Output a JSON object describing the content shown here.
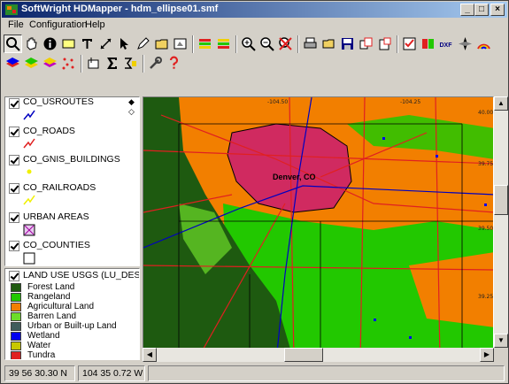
{
  "window": {
    "title": "SoftWright HDMapper - hdm_ellipse01.smf"
  },
  "caption_buttons": {
    "minimize": "_",
    "maximize": "□",
    "close": "×"
  },
  "menu": [
    "File",
    "Configuration",
    "Help"
  ],
  "toolbar": {
    "row1": [
      "zoom",
      "pan",
      "info",
      "label",
      "text",
      "measure",
      "select",
      "pencil",
      "area",
      "frame",
      "layers-a",
      "layers-b",
      "zoom-in",
      "zoom-out",
      "zoom-fit",
      "print",
      "open",
      "save",
      "copy",
      "paste",
      "checklist",
      "export",
      "dxf",
      "compass",
      "rainbow",
      "globe",
      "grid",
      "legend"
    ],
    "row2": [
      "layers-add",
      "layers-edit",
      "layers-select",
      "points",
      "frame-add",
      "sum",
      "sigma",
      "tools",
      "help"
    ],
    "dxf_label": "DXF"
  },
  "layers": [
    {
      "name": "CO_USROUTES",
      "checked": true,
      "symbol": "blue-line"
    },
    {
      "name": "CO_ROADS",
      "checked": true,
      "symbol": "red-line"
    },
    {
      "name": "CO_GNIS_BUILDINGS",
      "checked": true,
      "symbol": "yellow-dot"
    },
    {
      "name": "CO_RAILROADS",
      "checked": true,
      "symbol": "yellow-line"
    },
    {
      "name": "URBAN AREAS",
      "checked": true,
      "symbol": "magenta-hatch"
    },
    {
      "name": "CO_COUNTIES",
      "checked": true,
      "symbol": "black-box"
    }
  ],
  "landuse": {
    "name": "LAND USE USGS (LU_DESC)",
    "checked": true,
    "classes": [
      {
        "label": "Forest Land",
        "color": "#1e5a10"
      },
      {
        "label": "Rangeland",
        "color": "#22c800"
      },
      {
        "label": "Agricultural Land",
        "color": "#f27f00"
      },
      {
        "label": "Barren Land",
        "color": "#6cdc2a"
      },
      {
        "label": "Urban or Built-up Land",
        "color": "#405c5c"
      },
      {
        "label": "Wetland",
        "color": "#0000f0"
      },
      {
        "label": "Water",
        "color": "#c8c800"
      },
      {
        "label": "Tundra",
        "color": "#e02020"
      }
    ]
  },
  "map": {
    "city_label": "Denver, CO",
    "grid_labels": [
      "-104.50",
      "-104.25",
      "39.50",
      "39.75",
      "40.00",
      "39.25"
    ]
  },
  "status": {
    "lat": "39 56 30.30 N",
    "lon": "104 35 0.72 W",
    "third": ""
  }
}
